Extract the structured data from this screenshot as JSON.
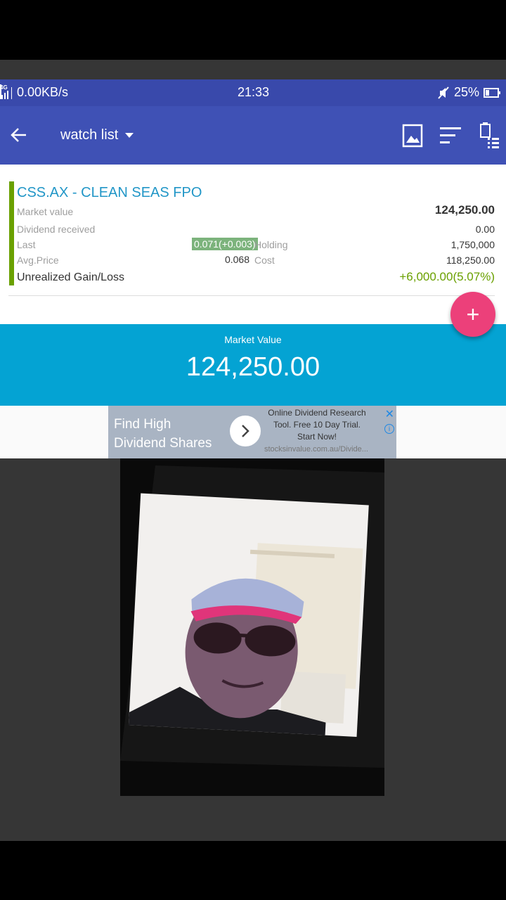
{
  "status_bar": {
    "network_tag": "4G",
    "speed": "0.00KB/s",
    "time": "21:33",
    "battery": "25%"
  },
  "app_bar": {
    "title": "watch list",
    "icons": [
      "back-arrow-icon",
      "image-icon",
      "sort-icon",
      "clipboard-list-icon"
    ]
  },
  "holding": {
    "title": "CSS.AX - CLEAN SEAS FPO",
    "market_value_label": "Market value",
    "market_value": "124,250.00",
    "dividend_label": "Dividend received",
    "dividend_value": "0.00",
    "last_label": "Last",
    "last_value": "0.071(+0.003)",
    "holding_label": "Holding",
    "holding_value": "1,750,000",
    "avg_price_label": "Avg.Price",
    "avg_price_value": "0.068",
    "cost_label": "Cost",
    "cost_value": "118,250.00",
    "gain_label": "Unrealized Gain/Loss",
    "gain_value": "+6,000.00(5.07%)"
  },
  "fab": {
    "label": "+"
  },
  "summary": {
    "label": "Market Value",
    "value": "124,250.00"
  },
  "ad": {
    "headline": "Find High Dividend Shares",
    "body": "Online Dividend Research Tool. Free 10 Day Trial. Start Now!",
    "url": "stocksinvalue.com.au/Divide...",
    "close": "✕",
    "info": "i"
  },
  "colors": {
    "status_bar": "#3949ab",
    "app_bar": "#3f51b5",
    "ticker": "#2196c7",
    "gain": "#6aa000",
    "fab": "#ec407a",
    "summary_panel": "#04a3d3"
  }
}
